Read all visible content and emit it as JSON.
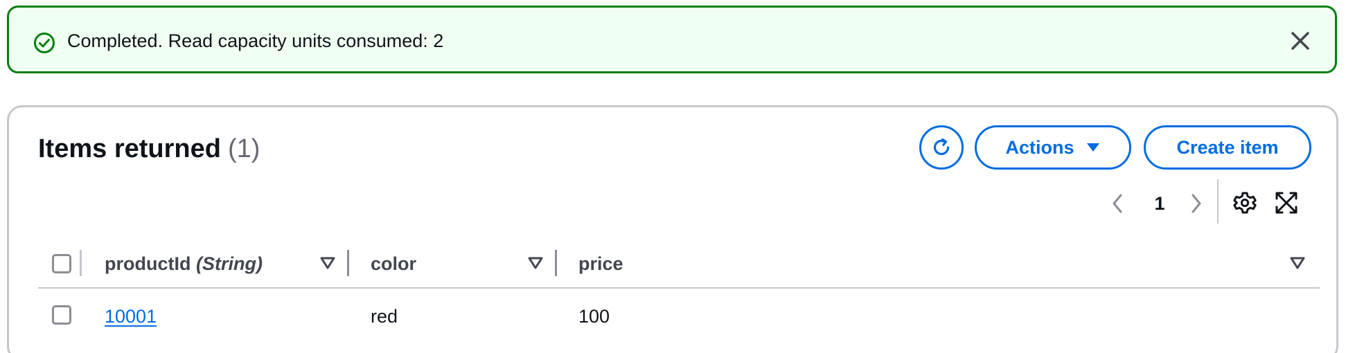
{
  "flash": {
    "status": "success",
    "icon": "status-success-icon",
    "message": "Completed. Read capacity units consumed: 2",
    "dismiss_icon": "close-icon"
  },
  "items_table": {
    "title": "Items returned",
    "count": "(1)",
    "refresh_icon": "refresh-icon",
    "actions_label": "Actions",
    "actions_icon": "caret-down-icon",
    "create_label": "Create item",
    "pagination": {
      "current_page": "1",
      "prev_icon": "angle-left-icon",
      "next_icon": "angle-right-icon"
    },
    "settings_icon": "gear-icon",
    "fullscreen_icon": "expand-icon",
    "columns": [
      {
        "name": "productId",
        "type": "(String)"
      },
      {
        "name": "color",
        "type": ""
      },
      {
        "name": "price",
        "type": ""
      }
    ],
    "rows": [
      {
        "productId": "10001",
        "color": "red",
        "price": "100"
      }
    ]
  },
  "colors": {
    "success_border": "#037f0c",
    "success_background": "#effff1",
    "link": "#006ce0",
    "button_border": "#006ce0",
    "container_border": "#c6c6cd",
    "disabled_icon": "#8c8c94"
  }
}
